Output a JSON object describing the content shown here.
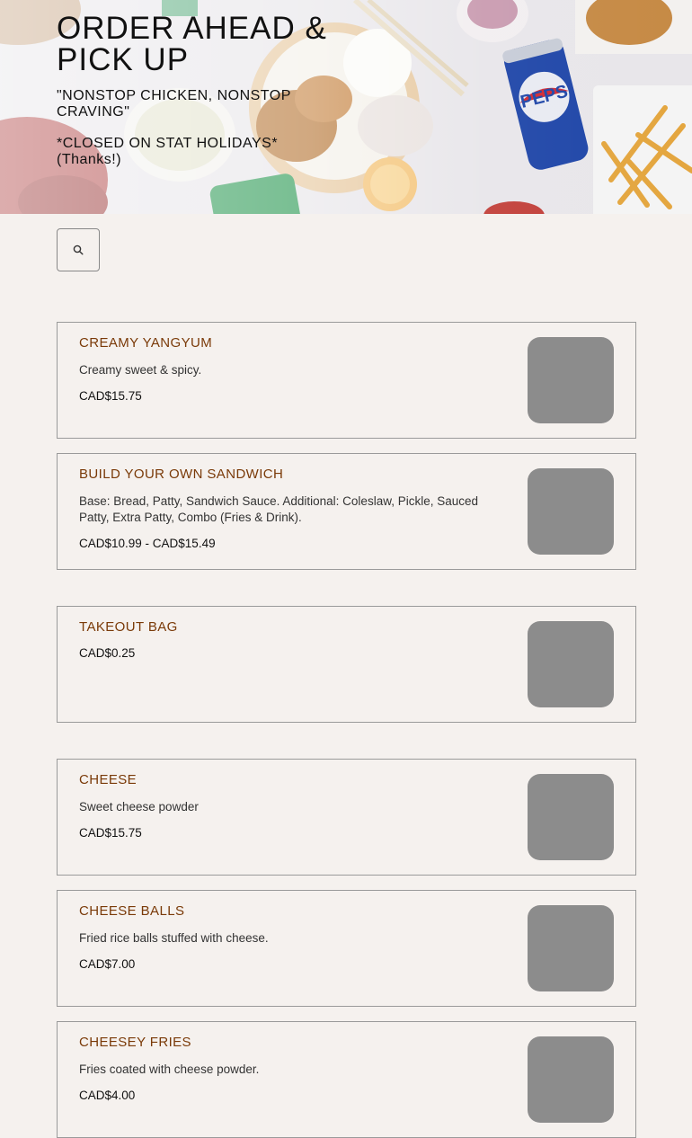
{
  "hero": {
    "title": "ORDER AHEAD & PICK UP",
    "tagline": "\"NONSTOP CHICKEN, NONSTOP CRAVING\"",
    "note": "*CLOSED ON STAT HOLIDAYS* (Thanks!)"
  },
  "search": {
    "icon": "search-icon"
  },
  "menu_items": [
    {
      "name": "CREAMY YANGYUM",
      "description": "Creamy sweet & spicy.",
      "price": "CAD$15.75"
    },
    {
      "name": "BUILD YOUR OWN SANDWICH",
      "description": "Base: Bread, Patty, Sandwich Sauce. Additional: Coleslaw, Pickle, Sauced Patty, Extra Patty, Combo (Fries & Drink).",
      "price": "CAD$10.99 - CAD$15.49"
    },
    {
      "name": "TAKEOUT BAG",
      "description": "",
      "price": "CAD$0.25"
    },
    {
      "name": "CHEESE",
      "description": "Sweet cheese powder",
      "price": "CAD$15.75"
    },
    {
      "name": "CHEESE BALLS",
      "description": "Fried rice balls stuffed with cheese.",
      "price": "CAD$7.00"
    },
    {
      "name": "CHEESEY FRIES",
      "description": "Fries coated with cheese powder.",
      "price": "CAD$4.00"
    }
  ],
  "colors": {
    "page_background": "#f5f1ee",
    "item_name": "#7a3a08",
    "card_border": "#9a9a9a",
    "image_placeholder": "#8c8c8c"
  }
}
